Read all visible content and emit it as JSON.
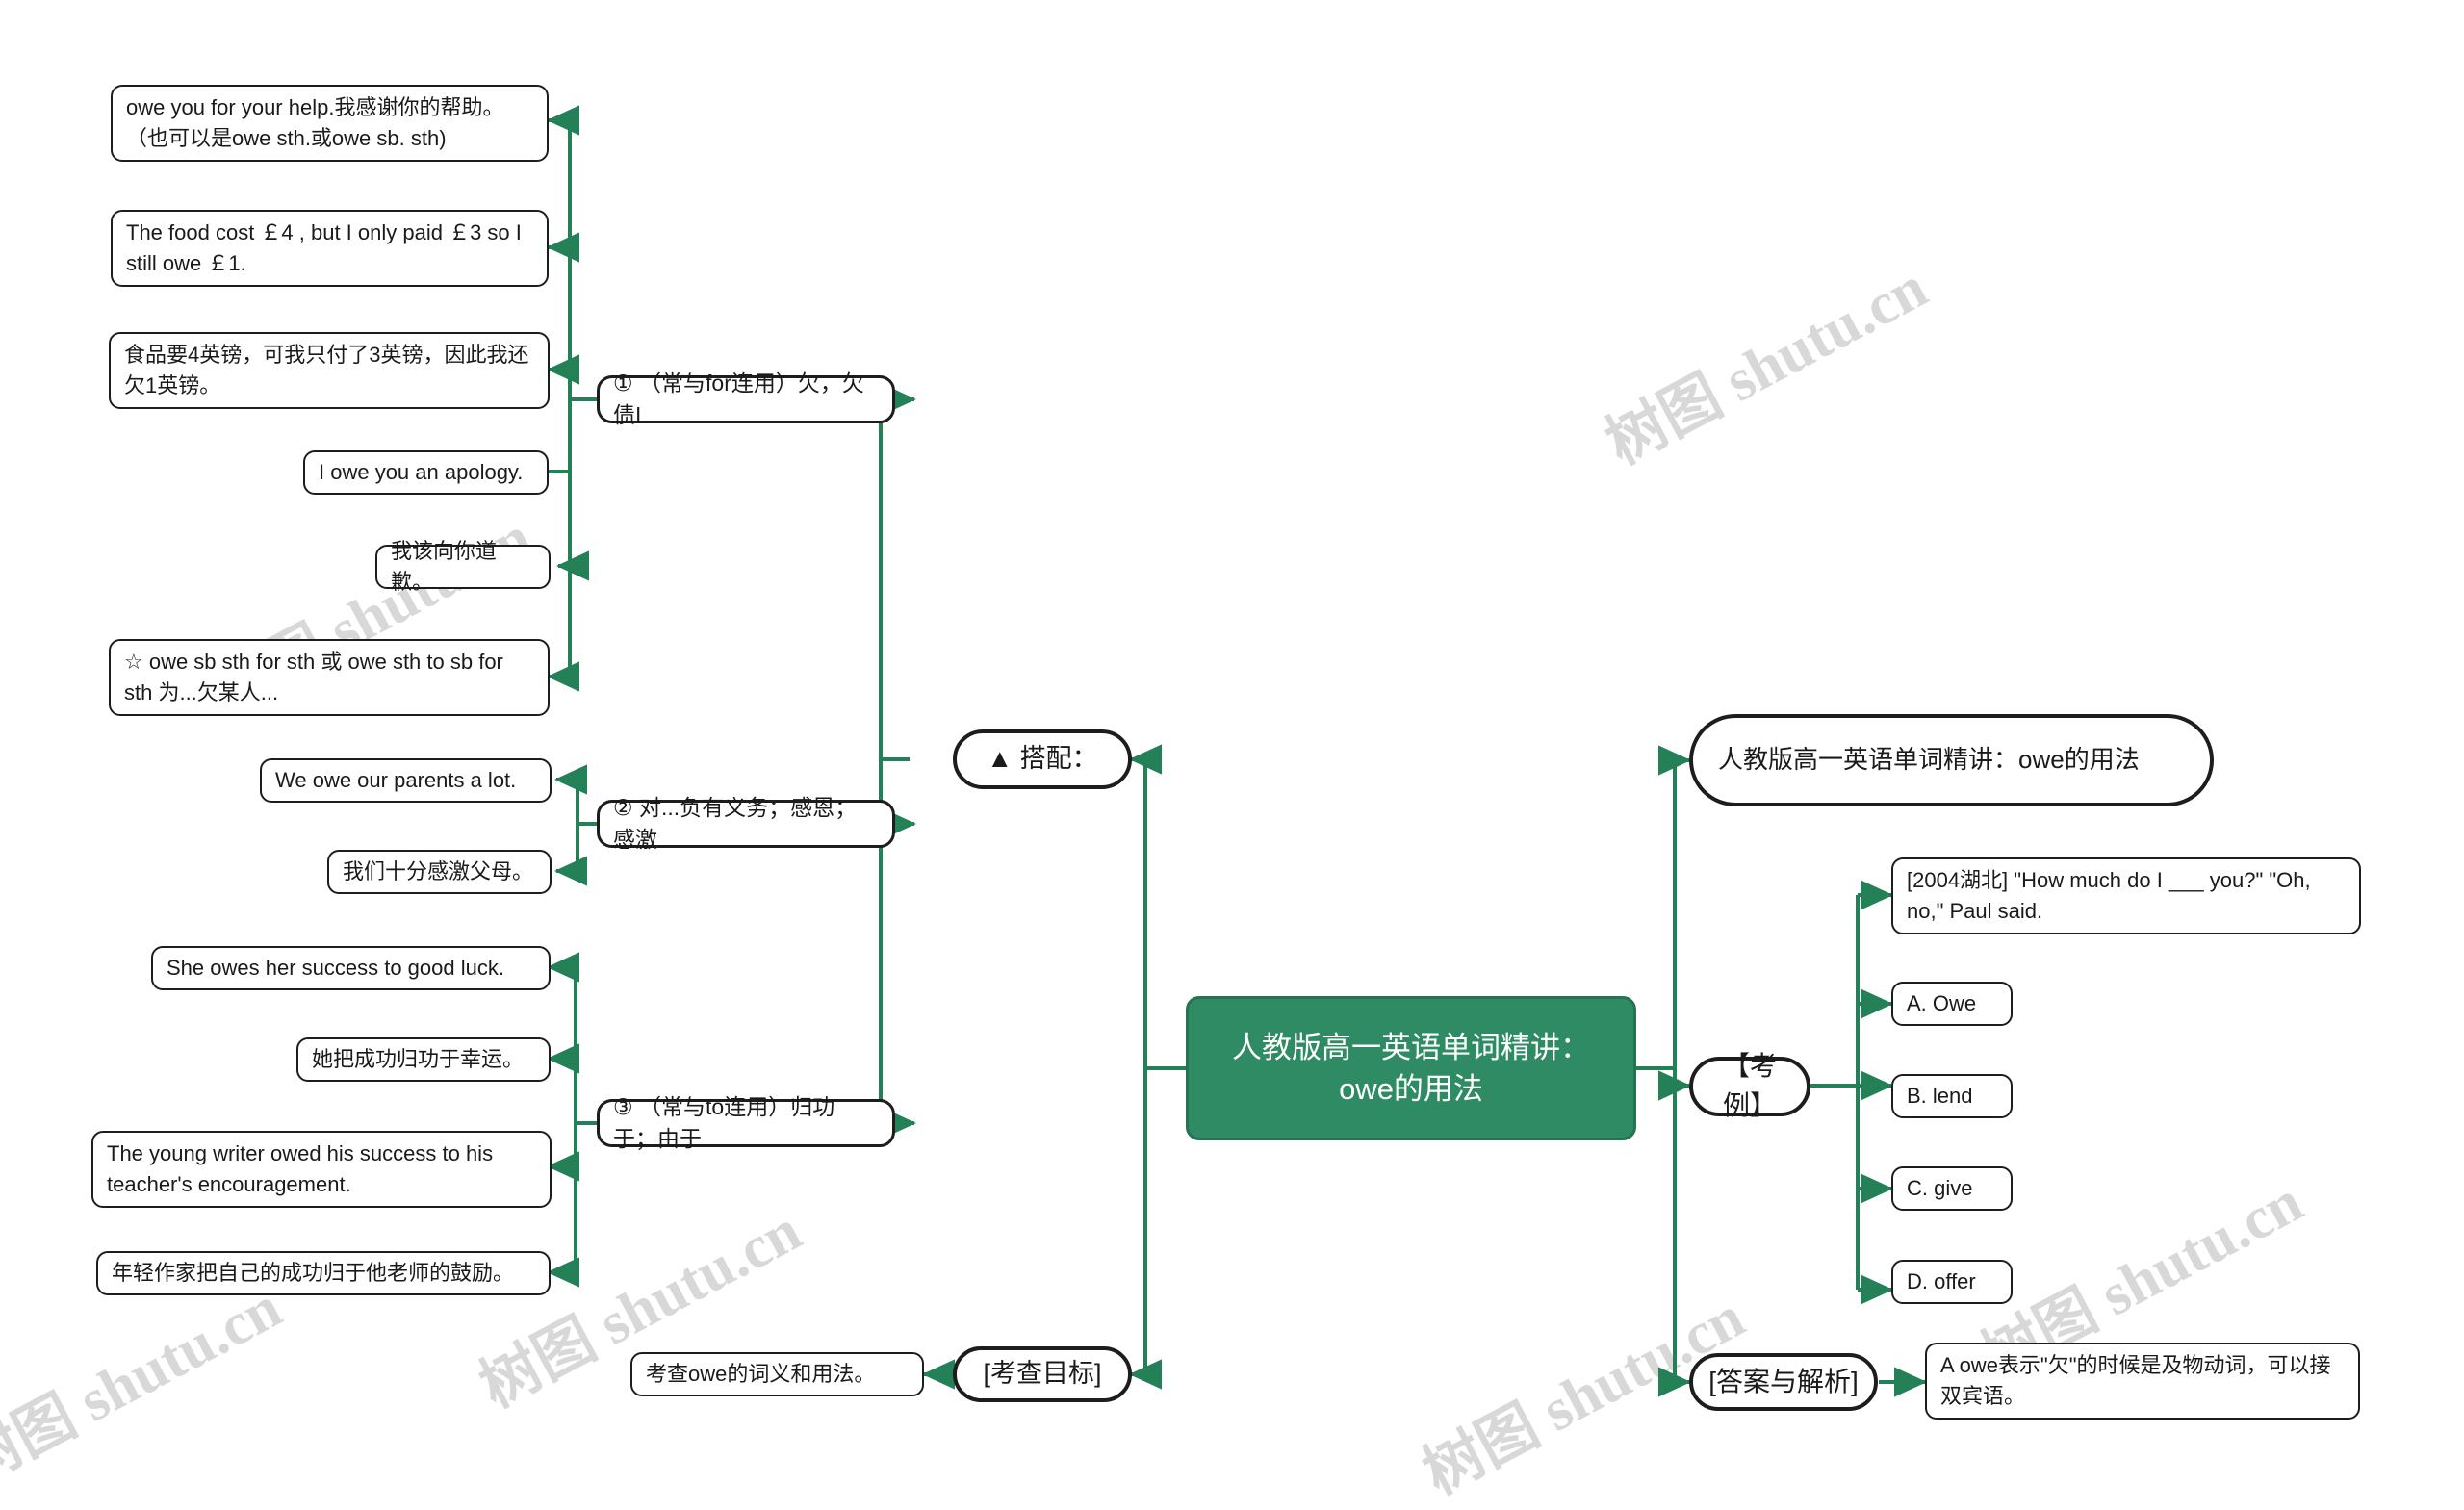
{
  "meta": {
    "watermark_text": "树图 shutu.cn",
    "accent_green": "#2e8b63",
    "link_green": "#248057",
    "node_border": "#1d1d1d",
    "background": "#ffffff"
  },
  "root": {
    "label": "人教版高一英语单词精讲：owe的用法"
  },
  "left": {
    "collocation_label": "▲ 搭配：",
    "exam_goal_label": "[考查目标]",
    "exam_goal_detail": "考查owe的词义和用法。",
    "senses": [
      {
        "label": "① （常与for连用）欠，欠债I",
        "examples": [
          "owe you for your help.我感谢你的帮助。（也可以是owe sth.或owe sb. sth)",
          "The food cost ￡4 , but I only paid ￡3 so I still owe ￡1.",
          "食品要4英镑，可我只付了3英镑，因此我还欠1英镑。",
          "I owe you an apology.",
          "我该向你道歉。",
          "☆ owe sb sth for sth 或 owe sth to sb for sth 为...欠某人..."
        ]
      },
      {
        "label": "② 对...负有义务；感恩；感激",
        "examples": [
          "We owe our parents a lot.",
          "我们十分感激父母。"
        ]
      },
      {
        "label": "③ （常与to连用）归功于；由于",
        "examples": [
          "She owes her success to good luck.",
          "她把成功归功于幸运。",
          "The young writer owed his success to his teacher's encouragement.",
          "年轻作家把自己的成功归于他老师的鼓励。"
        ]
      }
    ]
  },
  "right": {
    "title_node": "人教版高一英语单词精讲：owe的用法",
    "exam_case_label": "【考例】",
    "question": "[2004湖北] \"How much do I ___ you?\" \"Oh, no,\" Paul said.",
    "options": [
      "A. Owe",
      "B. lend",
      "C. give",
      "D. offer"
    ],
    "answer_label": "[答案与解析]",
    "answer_detail": "A owe表示\"欠\"的时候是及物动词，可以接双宾语。"
  }
}
